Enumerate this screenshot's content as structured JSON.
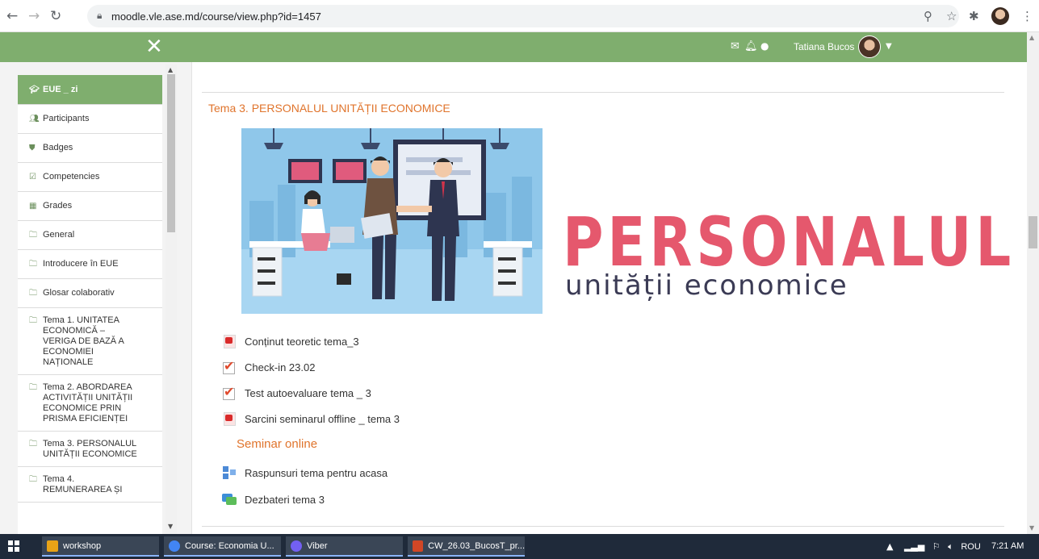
{
  "browser": {
    "url": "moodle.vle.ase.md/course/view.php?id=1457"
  },
  "topbar": {
    "user_name": "Tatiana Bucos"
  },
  "sidebar": {
    "items": [
      {
        "label": "EUE _ zi",
        "icon": "graduation-cap-icon",
        "active": true
      },
      {
        "label": "Participants",
        "icon": "users-icon"
      },
      {
        "label": "Badges",
        "icon": "shield-icon"
      },
      {
        "label": "Competencies",
        "icon": "checkbox-icon"
      },
      {
        "label": "Grades",
        "icon": "table-icon"
      },
      {
        "label": "General",
        "icon": "folder-icon"
      },
      {
        "label": "Introducere în EUE",
        "icon": "folder-icon"
      },
      {
        "label": "Glosar colaborativ",
        "icon": "folder-icon"
      },
      {
        "label": "Tema 1. UNITATEA ECONOMICĂ – VERIGA DE BAZĂ A ECONOMIEI NAȚIONALE",
        "icon": "folder-icon",
        "lines": [
          "Tema 1. UNITATEA",
          "ECONOMICĂ –",
          "VERIGA DE BAZĂ A",
          "ECONOMIEI",
          "NAȚIONALE"
        ]
      },
      {
        "label": "Tema 2. ABORDAREA ACTIVITĂȚII UNITĂȚII ECONOMICE PRIN PRISMA EFICIENȚEI",
        "icon": "folder-icon",
        "lines": [
          "Tema 2. ABORDAREA",
          "ACTIVITĂȚII UNITĂȚII",
          "ECONOMICE PRIN",
          "PRISMA EFICIENȚEI"
        ]
      },
      {
        "label": "Tema 3. PERSONALUL UNITĂȚII ECONOMICE",
        "icon": "folder-icon",
        "lines": [
          "Tema 3. PERSONALUL",
          "UNITĂȚII ECONOMICE"
        ]
      },
      {
        "label": "Tema 4. REMUNERAREA ȘI",
        "icon": "folder-icon",
        "lines": [
          "Tema 4.",
          "REMUNERAREA ȘI"
        ]
      }
    ]
  },
  "main": {
    "section_title": "Tema 3. PERSONALUL UNITĂȚII ECONOMICE",
    "banner": {
      "title": "PERSONALUL",
      "subtitle": "unității economice"
    },
    "activities": [
      {
        "label": "Conținut teoretic tema_3",
        "icon": "pdf-icon"
      },
      {
        "label": "Check-in 23.02",
        "icon": "quiz-check-icon"
      },
      {
        "label": "Test autoevaluare tema _ 3",
        "icon": "quiz-check-icon"
      },
      {
        "label": "Sarcini seminarul offline _ tema 3",
        "icon": "pdf-icon"
      }
    ],
    "seminar_label": "Seminar online",
    "activities_2": [
      {
        "label": "Raspunsuri tema pentru acasa",
        "icon": "database-icon"
      },
      {
        "label": "Dezbateri tema 3",
        "icon": "forum-icon"
      }
    ]
  },
  "taskbar": {
    "items": [
      {
        "label": "workshop",
        "color": "#e8a317"
      },
      {
        "label": "Course: Economia U...",
        "color": "#4285f4"
      },
      {
        "label": "Viber",
        "color": "#7360f2"
      },
      {
        "label": "CW_26.03_BucosT_pr...",
        "color": "#d24726"
      }
    ],
    "language": "ROU",
    "time": "7:21 AM"
  }
}
